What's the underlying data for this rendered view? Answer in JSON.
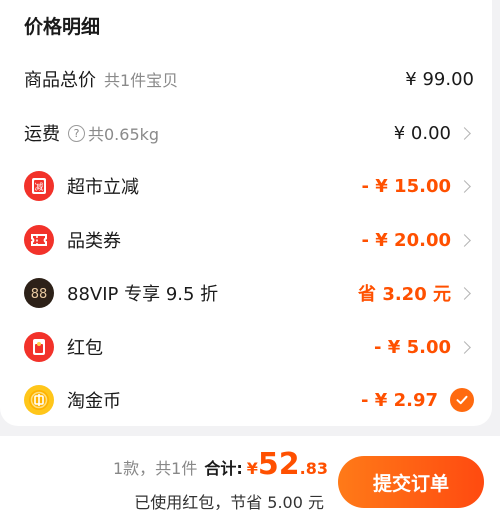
{
  "section_title": "价格明细",
  "rows": [
    {
      "label": "商品总价",
      "sub": "共1件宝贝",
      "amount": "¥ 99.00"
    },
    {
      "label": "运费",
      "sub": "共0.65kg",
      "amount": "¥ 0.00"
    },
    {
      "label": "超市立减",
      "amount": "- ¥ 15.00",
      "icon": "supermarket-discount-icon",
      "icon_text": "减"
    },
    {
      "label": "品类券",
      "amount": "- ¥ 20.00",
      "icon": "coupon-ticket-icon"
    },
    {
      "label": "88VIP 专享 9.5 折",
      "amount": "省 3.20 元",
      "icon": "88vip-badge-icon",
      "icon_text": "88"
    },
    {
      "label": "红包",
      "amount": "- ¥ 5.00",
      "icon": "red-envelope-icon"
    },
    {
      "label": "淘金币",
      "amount": "- ¥ 2.97",
      "icon": "taojinbi-coin-icon",
      "selected": true
    }
  ],
  "footer": {
    "count_text": "1款，共1件",
    "total_label": "合计:",
    "currency": "¥",
    "total_int": "52",
    "total_dec": ".83",
    "saved_text": "已使用红包，节省 5.00 元",
    "submit_label": "提交订单"
  },
  "colors": {
    "accent": "#ff5000",
    "icon_red": "#f2322a",
    "coin_gold": "#ffc61a",
    "vip_dark": "#2d2118"
  }
}
